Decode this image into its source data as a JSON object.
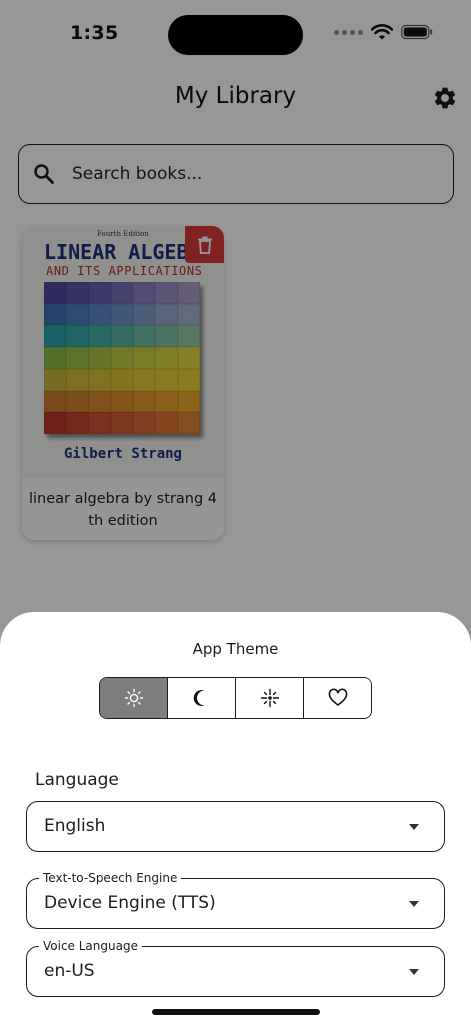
{
  "status_bar": {
    "time": "1:35"
  },
  "header": {
    "title": "My Library",
    "settings_icon": "gear-icon"
  },
  "search": {
    "placeholder": "Search books...",
    "value": ""
  },
  "books": [
    {
      "name": "linear algebra by strang 4 th edition",
      "cover": {
        "edition": "Fourth Edition",
        "title_line1": "LINEAR ALGEBRA",
        "title_line2": "AND ITS APPLICATIONS",
        "author": "Gilbert Strang"
      },
      "delete_icon": "trash-icon"
    }
  ],
  "settings_sheet": {
    "theme_title": "App Theme",
    "theme_options": [
      {
        "icon": "sun-icon",
        "selected": true
      },
      {
        "icon": "moon-icon",
        "selected": false
      },
      {
        "icon": "sparkle-icon",
        "selected": false
      },
      {
        "icon": "heart-icon",
        "selected": false
      }
    ],
    "language_label": "Language",
    "language_value": "English",
    "tts_label": "Text-to-Speech Engine",
    "tts_value": "Device Engine (TTS)",
    "voice_label": "Voice Language",
    "voice_value": "en-US"
  },
  "colors": {
    "delete": "#d63a3a",
    "selected_segment": "#7d7d7d",
    "cover_title": "#1b2f7a",
    "cover_subtitle": "#b22a2a"
  }
}
